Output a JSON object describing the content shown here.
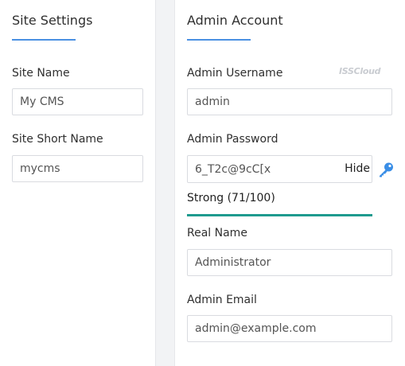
{
  "site_settings": {
    "title": "Site Settings",
    "site_name": {
      "label": "Site Name",
      "value": "My CMS"
    },
    "site_short_name": {
      "label": "Site Short Name",
      "value": "mycms"
    }
  },
  "admin_account": {
    "title": "Admin Account",
    "watermark": "ISSCloud",
    "username": {
      "label": "Admin Username",
      "value": "admin"
    },
    "password": {
      "label": "Admin Password",
      "value": "6_T2c@9cC[x",
      "toggle_label": "Hide",
      "strength_text": "Strong (71/100)",
      "strength_percent": 100,
      "strength_color": "#1f9b8f"
    },
    "real_name": {
      "label": "Real Name",
      "value": "Administrator"
    },
    "email": {
      "label": "Admin Email",
      "value": "admin@example.com"
    }
  },
  "colors": {
    "accent": "#4a90e2",
    "key_icon": "#3a8ee6"
  }
}
